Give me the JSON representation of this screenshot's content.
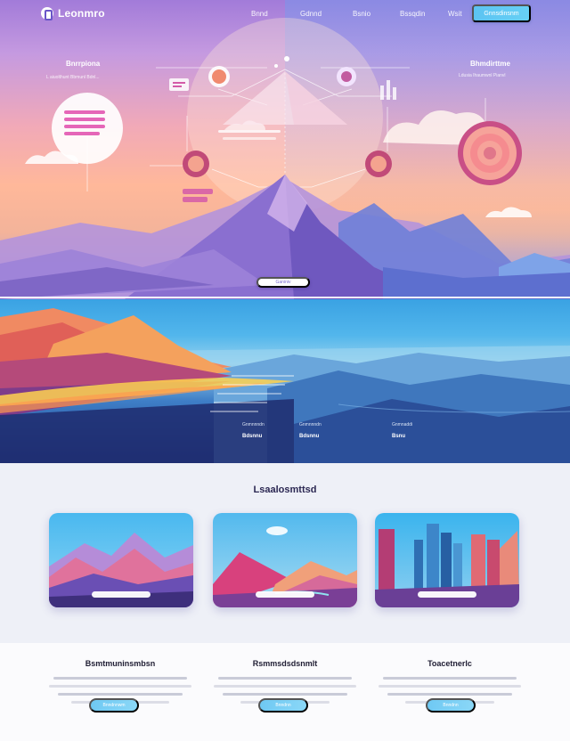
{
  "nav": {
    "logo_text": "Leonmro",
    "links": [
      "Bnnd",
      "Gdnnd",
      "Bsnio",
      "Bssqdin",
      "Wsit"
    ],
    "cta_label": "Gnnsdinsnm"
  },
  "hero": {
    "left_title": "Bnrrpiona",
    "left_sub": "L aiuolthunt  Bbmunl Bdnl...",
    "right_title": "Bhmdirttme",
    "right_sub": "Ldusia Ihaumwnl Pianvl",
    "cta_label": "Ganiniv"
  },
  "band": {
    "labels": [
      "Gnmnnndn",
      "Gnmnnndn",
      "Gnmnaddi"
    ],
    "values": [
      "Bdsnnu",
      "Bdsnnu",
      "Bsnu"
    ]
  },
  "gallery": {
    "title": "Lsaalosmttsd",
    "cards": [
      {
        "name": "mountains"
      },
      {
        "name": "hills"
      },
      {
        "name": "city"
      }
    ]
  },
  "features": [
    {
      "title": "Bsmtmuninsmbsn",
      "cta_label": "Bnndnnwm"
    },
    {
      "title": "Rsmmsdsdsnmlt",
      "cta_label": "Bnndnn"
    },
    {
      "title": "Toacetnerlc",
      "cta_label": "Bnndnn"
    }
  ],
  "colors": {
    "accent": "#5cc3f2",
    "heading": "#2b2752",
    "hero_top": "#a27bd9",
    "hero_mid": "#ffb89a"
  }
}
